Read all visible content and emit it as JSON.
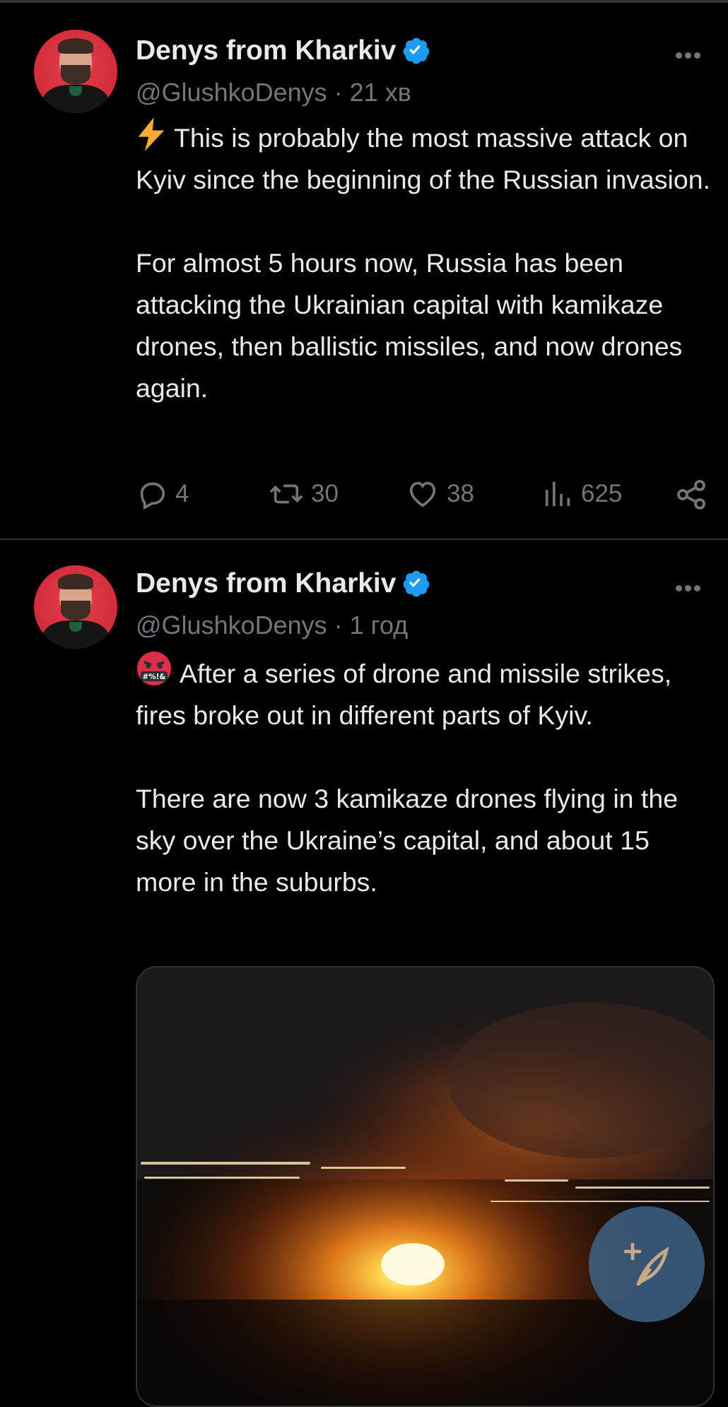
{
  "tweets": [
    {
      "author": {
        "name": "Denys from Kharkiv",
        "handle": "@GlushkoDenys",
        "time": "21 хв",
        "verified": true,
        "avatar_icon": "profile-photo"
      },
      "lead_emoji": "lightning-emoji",
      "text": "This is probably the most massive attack on Kyiv since the beginning of the Russian invasion.\n\nFor almost 5 hours now, Russia has been attacking the Ukrainian capital with kamikaze drones, then ballistic missiles, and now drones again.",
      "stats": {
        "replies": "4",
        "reposts": "30",
        "likes": "38",
        "views": "625"
      }
    },
    {
      "author": {
        "name": "Denys from Kharkiv",
        "handle": "@GlushkoDenys",
        "time": "1 год",
        "verified": true,
        "avatar_icon": "profile-photo"
      },
      "lead_emoji": "cursing-face-emoji",
      "cursing_symbols": "#%!&",
      "text": "After a series of drone and missile strikes, fires broke out in different parts of Kyiv.\n\nThere are now 3 kamikaze drones flying in the sky over the Ukraine’s capital, and about 15 more in the suburbs.",
      "media": {
        "type": "photo",
        "description_icon": "night-fire-photo"
      }
    }
  ],
  "separator": " · ",
  "fab": {
    "icon": "compose-post-icon"
  },
  "colors": {
    "background": "#000000",
    "text_primary": "#e7e9ea",
    "text_secondary": "#71767b",
    "verified": "#1d9bf0",
    "divider": "#2f3336"
  }
}
